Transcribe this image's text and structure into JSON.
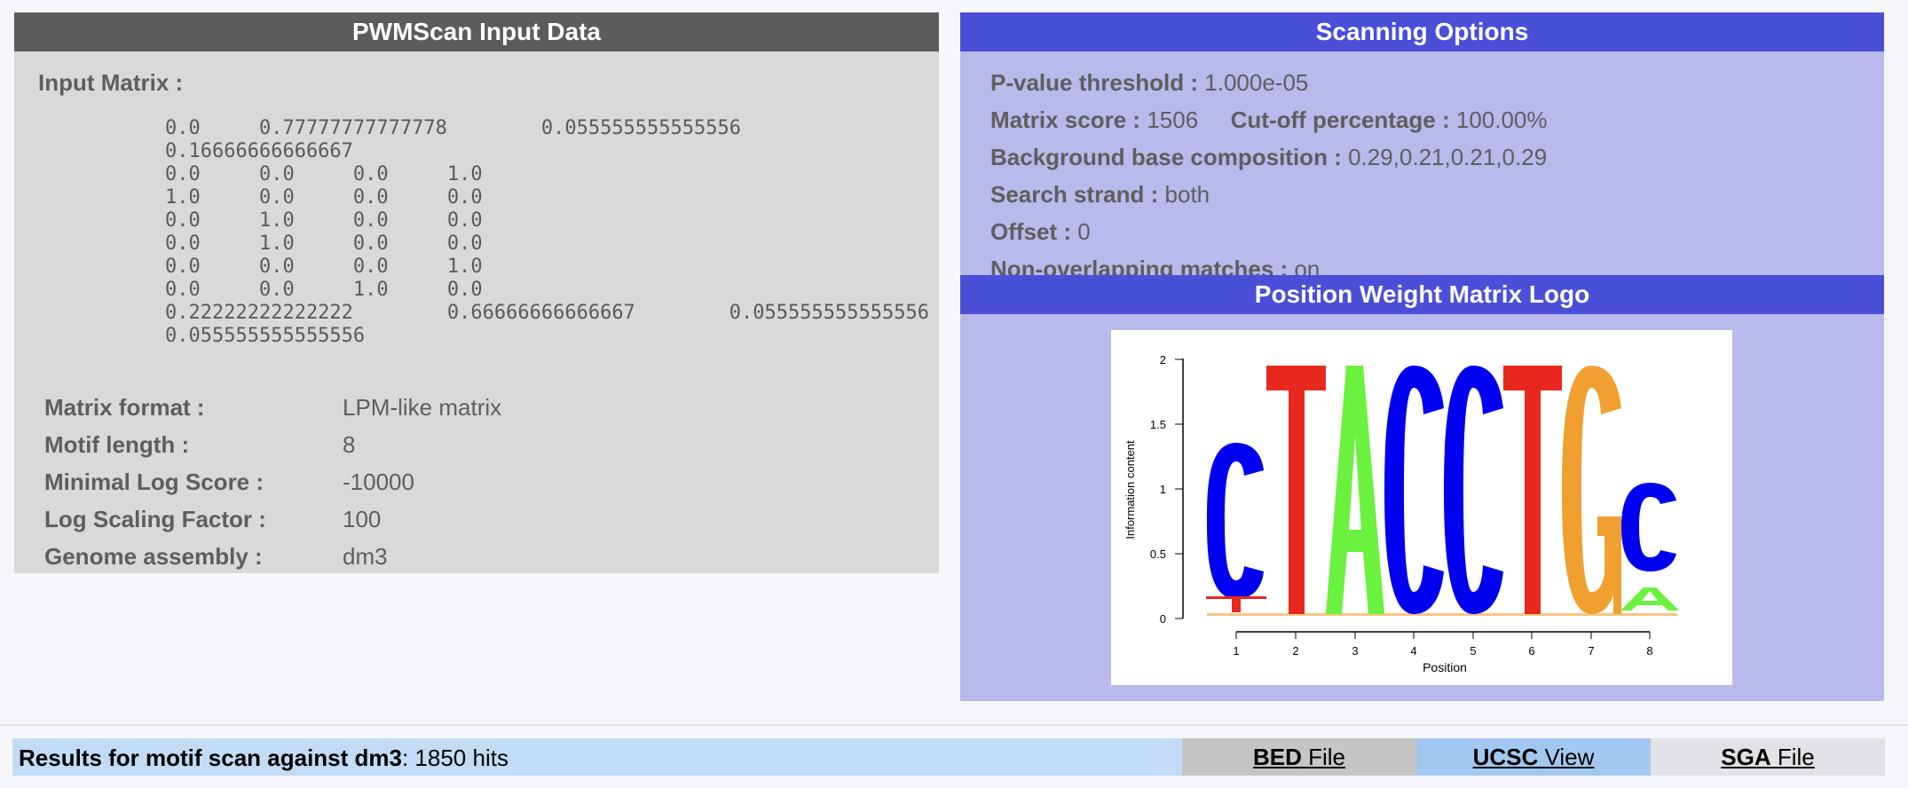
{
  "left": {
    "header": "PWMScan Input Data",
    "input_matrix_label": "Input Matrix :",
    "matrix_rows": [
      "0.0     0.77777777777778        0.055555555555556",
      "0.16666666666667",
      "0.0     0.0     0.0     1.0",
      "1.0     0.0     0.0     0.0",
      "0.0     1.0     0.0     0.0",
      "0.0     1.0     0.0     0.0",
      "0.0     0.0     0.0     1.0",
      "0.0     0.0     1.0     0.0",
      "0.22222222222222        0.66666666666667        0.055555555555556",
      "0.055555555555556"
    ],
    "info": [
      {
        "label": "Matrix format :",
        "value": "LPM-like matrix"
      },
      {
        "label": "Motif length :",
        "value": "8"
      },
      {
        "label": "Minimal Log Score :",
        "value": "-10000"
      },
      {
        "label": "Log Scaling Factor :",
        "value": "100"
      },
      {
        "label": "Genome assembly :",
        "value": "dm3"
      }
    ]
  },
  "right": {
    "header": "Scanning Options",
    "pvalue_label": "P-value threshold :",
    "pvalue_value": "1.000e-05",
    "matrix_score_label": "Matrix score :",
    "matrix_score_value": "1506",
    "cutoff_label": "Cut-off percentage :",
    "cutoff_value": "100.00%",
    "background_label": "Background base composition :",
    "background_value": "0.29,0.21,0.21,0.29",
    "strand_label": "Search strand :",
    "strand_value": "both",
    "offset_label": "Offset :",
    "offset_value": "0",
    "nonoverlap_label": "Non-overlapping matches :",
    "nonoverlap_value": "on",
    "logo_header": "Position Weight Matrix Logo"
  },
  "logo": {
    "ylabel": "Information content",
    "xlabel": "Position",
    "yticks": [
      "0",
      "0.5",
      "1",
      "1.5",
      "2"
    ],
    "xticks": [
      "1",
      "2",
      "3",
      "4",
      "5",
      "6",
      "7",
      "8"
    ],
    "colors": {
      "A": "#6bf23e",
      "C": "#0000f0",
      "G": "#f0a030",
      "T": "#e8281e"
    }
  },
  "results": {
    "label_bold": "Results for motif scan against dm3",
    "suffix": ": 1850 hits",
    "bed_bold": "BED",
    "bed_rest": " File",
    "ucsc_bold": "UCSC",
    "ucsc_rest": " View",
    "sga_bold": "SGA",
    "sga_rest": " File"
  }
}
